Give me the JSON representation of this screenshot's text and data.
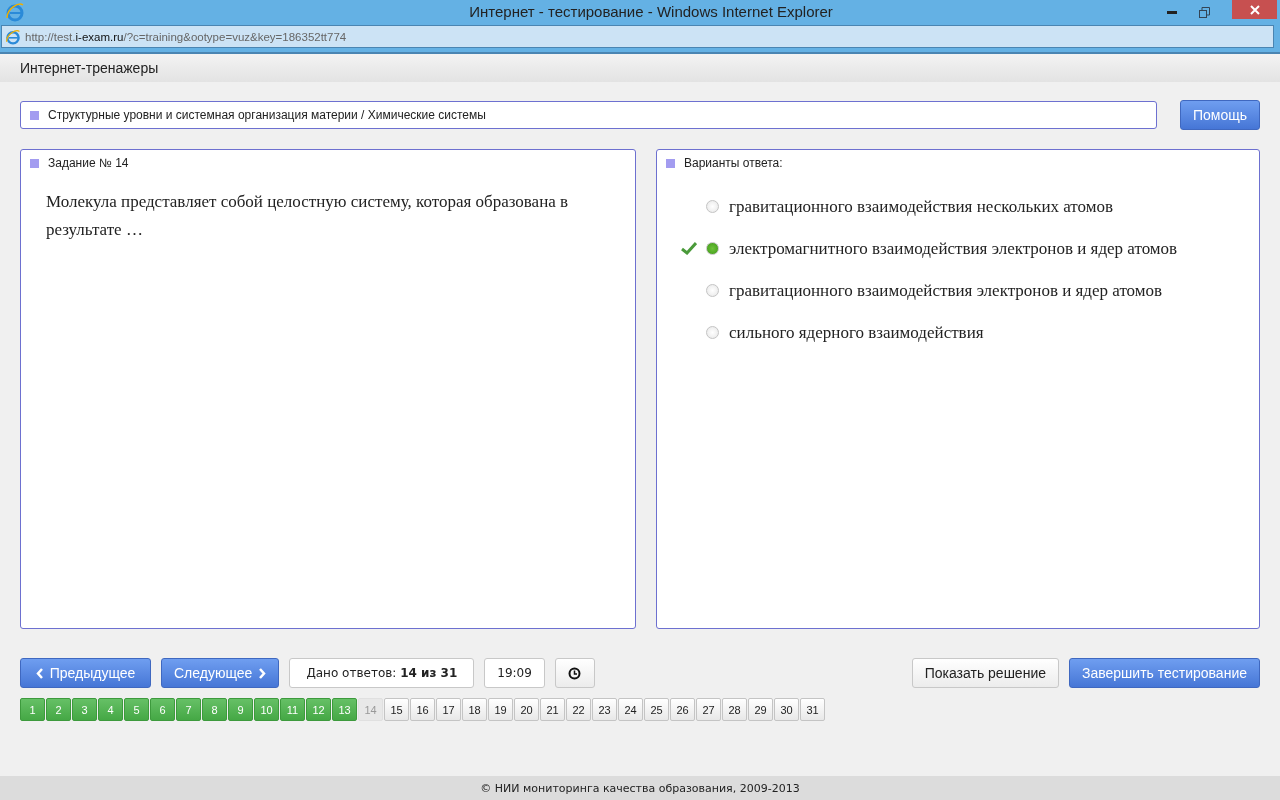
{
  "window": {
    "title": "Интернет - тестирование - Windows Internet Explorer"
  },
  "address": {
    "prefix": "http://test.",
    "domain": "i-exam.ru",
    "path": "/?c=training&ootype=vuz&key=186352tt774"
  },
  "app_title": "Интернет-тренажеры",
  "topic": "Структурные уровни и системная организация материи / Химические системы",
  "help_button": "Помощь",
  "task": {
    "heading": "Задание № 14",
    "question": "Молекула представляет собой целостную систему, которая образована в результате …"
  },
  "answers": {
    "heading": "Варианты ответа:",
    "options": [
      {
        "text": "гравитационного взаимодействия нескольких атомов",
        "selected": false,
        "marked_correct": false
      },
      {
        "text": "электромагнитного взаимодействия электронов и ядер атомов",
        "selected": true,
        "marked_correct": true
      },
      {
        "text": "гравитационного взаимодействия электронов и ядер атомов",
        "selected": false,
        "marked_correct": false
      },
      {
        "text": "сильного ядерного взаимодействия",
        "selected": false,
        "marked_correct": false
      }
    ]
  },
  "nav": {
    "prev": "Предыдущее",
    "next": "Следующее",
    "answered_label": "Дано ответов:",
    "answered_value": "14 из 31",
    "timer": "19:09",
    "show_solution": "Показать решение",
    "finish": "Завершить тестирование"
  },
  "pages": [
    {
      "label": "1",
      "answered": true,
      "current": false
    },
    {
      "label": "2",
      "answered": true,
      "current": false
    },
    {
      "label": "3",
      "answered": true,
      "current": false
    },
    {
      "label": "4",
      "answered": true,
      "current": false
    },
    {
      "label": "5",
      "answered": true,
      "current": false
    },
    {
      "label": "6",
      "answered": true,
      "current": false
    },
    {
      "label": "7",
      "answered": true,
      "current": false
    },
    {
      "label": "8",
      "answered": true,
      "current": false
    },
    {
      "label": "9",
      "answered": true,
      "current": false
    },
    {
      "label": "10",
      "answered": true,
      "current": false
    },
    {
      "label": "11",
      "answered": true,
      "current": false
    },
    {
      "label": "12",
      "answered": true,
      "current": false
    },
    {
      "label": "13",
      "answered": true,
      "current": false
    },
    {
      "label": "14",
      "answered": false,
      "current": true
    },
    {
      "label": "15",
      "answered": false,
      "current": false
    },
    {
      "label": "16",
      "answered": false,
      "current": false
    },
    {
      "label": "17",
      "answered": false,
      "current": false
    },
    {
      "label": "18",
      "answered": false,
      "current": false
    },
    {
      "label": "19",
      "answered": false,
      "current": false
    },
    {
      "label": "20",
      "answered": false,
      "current": false
    },
    {
      "label": "21",
      "answered": false,
      "current": false
    },
    {
      "label": "22",
      "answered": false,
      "current": false
    },
    {
      "label": "23",
      "answered": false,
      "current": false
    },
    {
      "label": "24",
      "answered": false,
      "current": false
    },
    {
      "label": "25",
      "answered": false,
      "current": false
    },
    {
      "label": "26",
      "answered": false,
      "current": false
    },
    {
      "label": "27",
      "answered": false,
      "current": false
    },
    {
      "label": "28",
      "answered": false,
      "current": false
    },
    {
      "label": "29",
      "answered": false,
      "current": false
    },
    {
      "label": "30",
      "answered": false,
      "current": false
    },
    {
      "label": "31",
      "answered": false,
      "current": false
    }
  ],
  "footer": "© НИИ мониторинга качества образования, 2009-2013"
}
